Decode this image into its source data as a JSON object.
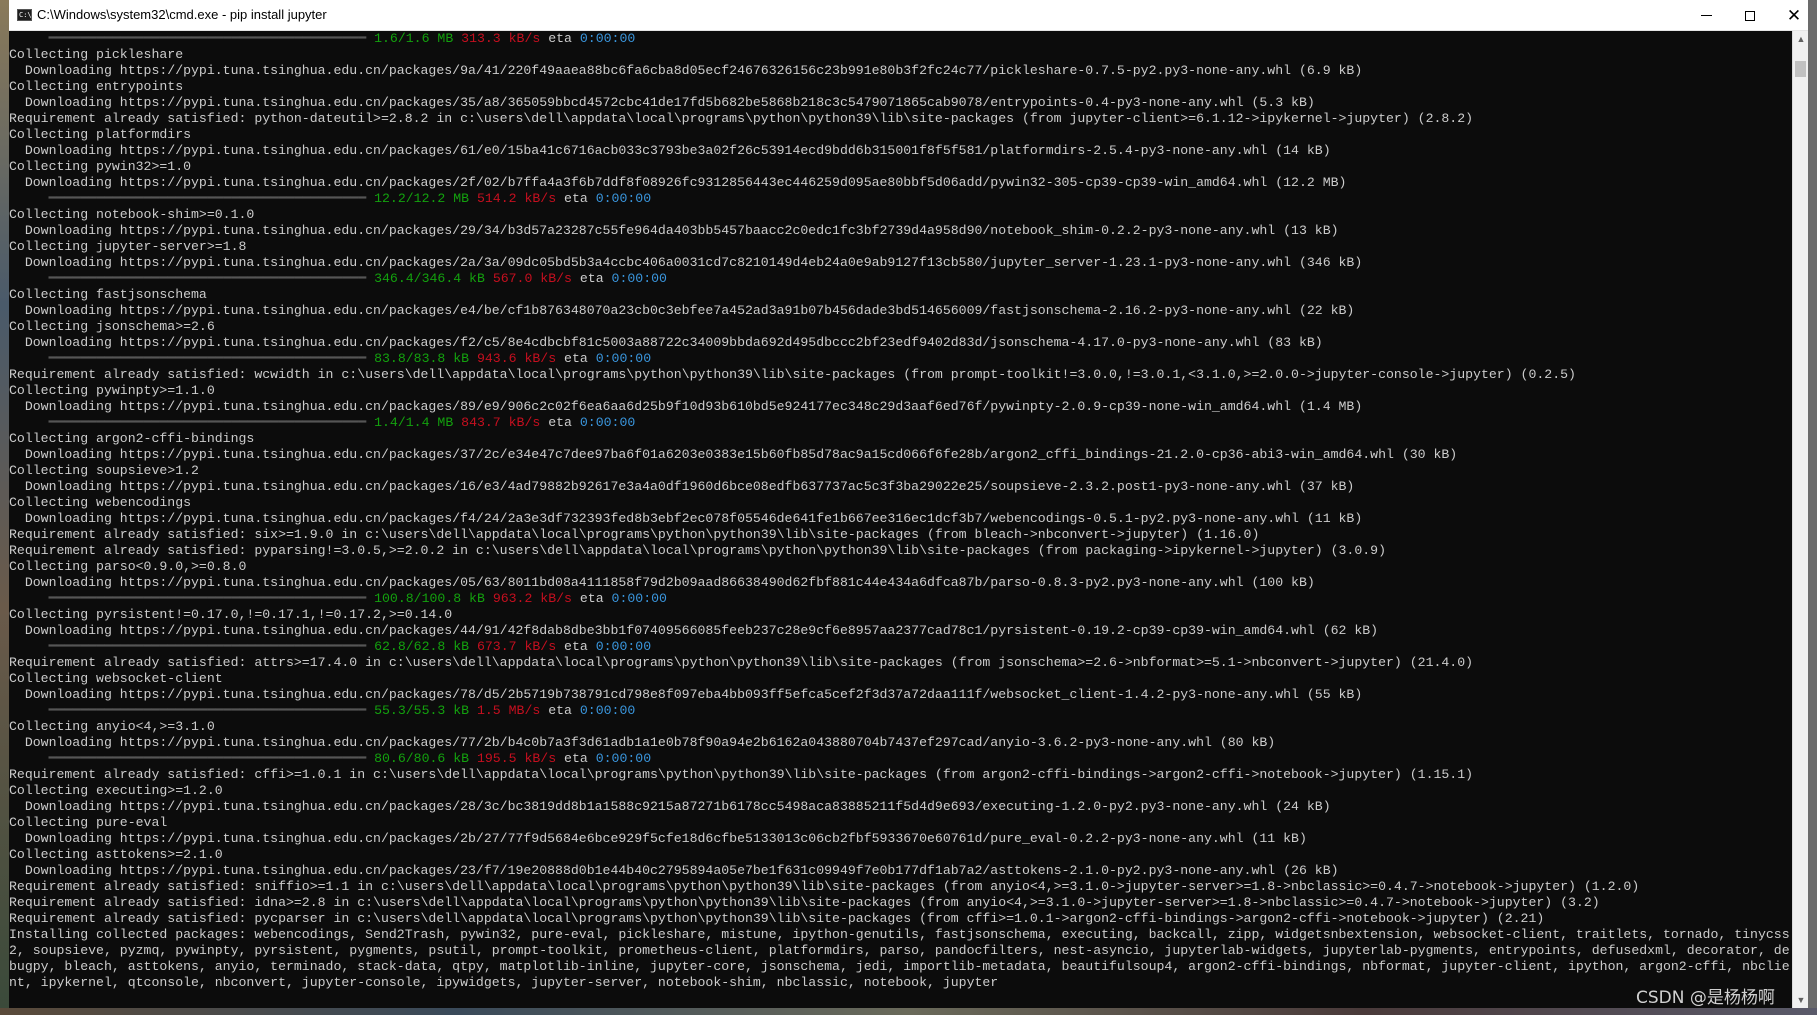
{
  "window": {
    "title": "C:\\Windows\\system32\\cmd.exe - pip  install jupyter",
    "icon": "console-icon",
    "controls": {
      "minimize": "minimize-icon",
      "maximize": "maximize-icon",
      "close": "✕"
    }
  },
  "colors": {
    "progress_size": "#13a10e",
    "progress_rate": "#c50f1f",
    "progress_eta": "#3a96dd",
    "text": "#cccccc",
    "background": "#0c0c0c"
  },
  "console": {
    "lines": [
      {
        "type": "progress",
        "indent": "     ",
        "bar": "━━━━━━━━━━━━━━━━━━━━━━━━━━━━━━━━━━━━━━━━",
        "size": "1.6/1.6 MB",
        "rate": "313.3 kB/s",
        "eta_label": "eta",
        "eta": "0:00:00"
      },
      {
        "type": "text",
        "text": "Collecting pickleshare"
      },
      {
        "type": "text",
        "text": "  Downloading https://pypi.tuna.tsinghua.edu.cn/packages/9a/41/220f49aaea88bc6fa6cba8d05ecf24676326156c23b991e80b3f2fc24c77/pickleshare-0.7.5-py2.py3-none-any.whl (6.9 kB)"
      },
      {
        "type": "text",
        "text": "Collecting entrypoints"
      },
      {
        "type": "text",
        "text": "  Downloading https://pypi.tuna.tsinghua.edu.cn/packages/35/a8/365059bbcd4572cbc41de17fd5b682be5868b218c3c5479071865cab9078/entrypoints-0.4-py3-none-any.whl (5.3 kB)"
      },
      {
        "type": "text",
        "text": "Requirement already satisfied: python-dateutil>=2.8.2 in c:\\users\\dell\\appdata\\local\\programs\\python\\python39\\lib\\site-packages (from jupyter-client>=6.1.12->ipykernel->jupyter) (2.8.2)"
      },
      {
        "type": "text",
        "text": "Collecting platformdirs"
      },
      {
        "type": "text",
        "text": "  Downloading https://pypi.tuna.tsinghua.edu.cn/packages/61/e0/15ba41c6716acb033c3793be3a02f26c53914ecd9bdd6b315001f8f5f581/platformdirs-2.5.4-py3-none-any.whl (14 kB)"
      },
      {
        "type": "text",
        "text": "Collecting pywin32>=1.0"
      },
      {
        "type": "text",
        "text": "  Downloading https://pypi.tuna.tsinghua.edu.cn/packages/2f/02/b7ffa4a3f6b7ddf8f08926fc9312856443ec446259d095ae80bbf5d06add/pywin32-305-cp39-cp39-win_amd64.whl (12.2 MB)"
      },
      {
        "type": "progress",
        "indent": "     ",
        "bar": "━━━━━━━━━━━━━━━━━━━━━━━━━━━━━━━━━━━━━━━━",
        "size": "12.2/12.2 MB",
        "rate": "514.2 kB/s",
        "eta_label": "eta",
        "eta": "0:00:00"
      },
      {
        "type": "text",
        "text": "Collecting notebook-shim>=0.1.0"
      },
      {
        "type": "text",
        "text": "  Downloading https://pypi.tuna.tsinghua.edu.cn/packages/29/34/b3d57a23287c55fe964da403bb5457baacc2c0edc1fc3bf2739d4a958d90/notebook_shim-0.2.2-py3-none-any.whl (13 kB)"
      },
      {
        "type": "text",
        "text": "Collecting jupyter-server>=1.8"
      },
      {
        "type": "text",
        "text": "  Downloading https://pypi.tuna.tsinghua.edu.cn/packages/2a/3a/09dc05bd5b3a4ccbc406a0031cd7c8210149d4eb24a0e9ab9127f13cb580/jupyter_server-1.23.1-py3-none-any.whl (346 kB)"
      },
      {
        "type": "progress",
        "indent": "     ",
        "bar": "━━━━━━━━━━━━━━━━━━━━━━━━━━━━━━━━━━━━━━━━",
        "size": "346.4/346.4 kB",
        "rate": "567.0 kB/s",
        "eta_label": "eta",
        "eta": "0:00:00"
      },
      {
        "type": "text",
        "text": "Collecting fastjsonschema"
      },
      {
        "type": "text",
        "text": "  Downloading https://pypi.tuna.tsinghua.edu.cn/packages/e4/be/cf1b876348070a23cb0c3ebfee7a452ad3a91b07b456dade3bd514656009/fastjsonschema-2.16.2-py3-none-any.whl (22 kB)"
      },
      {
        "type": "text",
        "text": "Collecting jsonschema>=2.6"
      },
      {
        "type": "text",
        "text": "  Downloading https://pypi.tuna.tsinghua.edu.cn/packages/f2/c5/8e4cdbcbf81c5003a88722c34009bbda692d495dbccc2bf23edf9402d83d/jsonschema-4.17.0-py3-none-any.whl (83 kB)"
      },
      {
        "type": "progress",
        "indent": "     ",
        "bar": "━━━━━━━━━━━━━━━━━━━━━━━━━━━━━━━━━━━━━━━━",
        "size": "83.8/83.8 kB",
        "rate": "943.6 kB/s",
        "eta_label": "eta",
        "eta": "0:00:00"
      },
      {
        "type": "text",
        "text": "Requirement already satisfied: wcwidth in c:\\users\\dell\\appdata\\local\\programs\\python\\python39\\lib\\site-packages (from prompt-toolkit!=3.0.0,!=3.0.1,<3.1.0,>=2.0.0->jupyter-console->jupyter) (0.2.5)"
      },
      {
        "type": "text",
        "text": "Collecting pywinpty>=1.1.0"
      },
      {
        "type": "text",
        "text": "  Downloading https://pypi.tuna.tsinghua.edu.cn/packages/89/e9/906c2c02f6ea6aa6d25b9f10d93b610bd5e924177ec348c29d3aaf6ed76f/pywinpty-2.0.9-cp39-none-win_amd64.whl (1.4 MB)"
      },
      {
        "type": "progress",
        "indent": "     ",
        "bar": "━━━━━━━━━━━━━━━━━━━━━━━━━━━━━━━━━━━━━━━━",
        "size": "1.4/1.4 MB",
        "rate": "843.7 kB/s",
        "eta_label": "eta",
        "eta": "0:00:00"
      },
      {
        "type": "text",
        "text": "Collecting argon2-cffi-bindings"
      },
      {
        "type": "text",
        "text": "  Downloading https://pypi.tuna.tsinghua.edu.cn/packages/37/2c/e34e47c7dee97ba6f01a6203e0383e15b60fb85d78ac9a15cd066f6fe28b/argon2_cffi_bindings-21.2.0-cp36-abi3-win_amd64.whl (30 kB)"
      },
      {
        "type": "text",
        "text": "Collecting soupsieve>1.2"
      },
      {
        "type": "text",
        "text": "  Downloading https://pypi.tuna.tsinghua.edu.cn/packages/16/e3/4ad79882b92617e3a4a0df1960d6bce08edfb637737ac5c3f3ba29022e25/soupsieve-2.3.2.post1-py3-none-any.whl (37 kB)"
      },
      {
        "type": "text",
        "text": "Collecting webencodings"
      },
      {
        "type": "text",
        "text": "  Downloading https://pypi.tuna.tsinghua.edu.cn/packages/f4/24/2a3e3df732393fed8b3ebf2ec078f05546de641fe1b667ee316ec1dcf3b7/webencodings-0.5.1-py2.py3-none-any.whl (11 kB)"
      },
      {
        "type": "text",
        "text": "Requirement already satisfied: six>=1.9.0 in c:\\users\\dell\\appdata\\local\\programs\\python\\python39\\lib\\site-packages (from bleach->nbconvert->jupyter) (1.16.0)"
      },
      {
        "type": "text",
        "text": "Requirement already satisfied: pyparsing!=3.0.5,>=2.0.2 in c:\\users\\dell\\appdata\\local\\programs\\python\\python39\\lib\\site-packages (from packaging->ipykernel->jupyter) (3.0.9)"
      },
      {
        "type": "text",
        "text": "Collecting parso<0.9.0,>=0.8.0"
      },
      {
        "type": "text",
        "text": "  Downloading https://pypi.tuna.tsinghua.edu.cn/packages/05/63/8011bd08a4111858f79d2b09aad86638490d62fbf881c44e434a6dfca87b/parso-0.8.3-py2.py3-none-any.whl (100 kB)"
      },
      {
        "type": "progress",
        "indent": "     ",
        "bar": "━━━━━━━━━━━━━━━━━━━━━━━━━━━━━━━━━━━━━━━━",
        "size": "100.8/100.8 kB",
        "rate": "963.2 kB/s",
        "eta_label": "eta",
        "eta": "0:00:00"
      },
      {
        "type": "text",
        "text": "Collecting pyrsistent!=0.17.0,!=0.17.1,!=0.17.2,>=0.14.0"
      },
      {
        "type": "text",
        "text": "  Downloading https://pypi.tuna.tsinghua.edu.cn/packages/44/91/42f8dab8dbe3bb1f07409566085feeb237c28e9cf6e8957aa2377cad78c1/pyrsistent-0.19.2-cp39-cp39-win_amd64.whl (62 kB)"
      },
      {
        "type": "progress",
        "indent": "     ",
        "bar": "━━━━━━━━━━━━━━━━━━━━━━━━━━━━━━━━━━━━━━━━",
        "size": "62.8/62.8 kB",
        "rate": "673.7 kB/s",
        "eta_label": "eta",
        "eta": "0:00:00"
      },
      {
        "type": "text",
        "text": "Requirement already satisfied: attrs>=17.4.0 in c:\\users\\dell\\appdata\\local\\programs\\python\\python39\\lib\\site-packages (from jsonschema>=2.6->nbformat>=5.1->nbconvert->jupyter) (21.4.0)"
      },
      {
        "type": "text",
        "text": "Collecting websocket-client"
      },
      {
        "type": "text",
        "text": "  Downloading https://pypi.tuna.tsinghua.edu.cn/packages/78/d5/2b5719b738791cd798e8f097eba4bb093ff5efca5cef2f3d37a72daa111f/websocket_client-1.4.2-py3-none-any.whl (55 kB)"
      },
      {
        "type": "progress",
        "indent": "     ",
        "bar": "━━━━━━━━━━━━━━━━━━━━━━━━━━━━━━━━━━━━━━━━",
        "size": "55.3/55.3 kB",
        "rate": "1.5 MB/s",
        "eta_label": "eta",
        "eta": "0:00:00"
      },
      {
        "type": "text",
        "text": "Collecting anyio<4,>=3.1.0"
      },
      {
        "type": "text",
        "text": "  Downloading https://pypi.tuna.tsinghua.edu.cn/packages/77/2b/b4c0b7a3f3d61adb1a1e0b78f90a94e2b6162a043880704b7437ef297cad/anyio-3.6.2-py3-none-any.whl (80 kB)"
      },
      {
        "type": "progress",
        "indent": "     ",
        "bar": "━━━━━━━━━━━━━━━━━━━━━━━━━━━━━━━━━━━━━━━━",
        "size": "80.6/80.6 kB",
        "rate": "195.5 kB/s",
        "eta_label": "eta",
        "eta": "0:00:00"
      },
      {
        "type": "text",
        "text": "Requirement already satisfied: cffi>=1.0.1 in c:\\users\\dell\\appdata\\local\\programs\\python\\python39\\lib\\site-packages (from argon2-cffi-bindings->argon2-cffi->notebook->jupyter) (1.15.1)"
      },
      {
        "type": "text",
        "text": "Collecting executing>=1.2.0"
      },
      {
        "type": "text",
        "text": "  Downloading https://pypi.tuna.tsinghua.edu.cn/packages/28/3c/bc3819dd8b1a1588c9215a87271b6178cc5498aca83885211f5d4d9e693/executing-1.2.0-py2.py3-none-any.whl (24 kB)"
      },
      {
        "type": "text",
        "text": "Collecting pure-eval"
      },
      {
        "type": "text",
        "text": "  Downloading https://pypi.tuna.tsinghua.edu.cn/packages/2b/27/77f9d5684e6bce929f5cfe18d6cfbe5133013c06cb2fbf5933670e60761d/pure_eval-0.2.2-py3-none-any.whl (11 kB)"
      },
      {
        "type": "text",
        "text": "Collecting asttokens>=2.1.0"
      },
      {
        "type": "text",
        "text": "  Downloading https://pypi.tuna.tsinghua.edu.cn/packages/23/f7/19e20888d0b1e44b40c2795894a05e7be1f631c09949f7e0b177df1ab7a2/asttokens-2.1.0-py2.py3-none-any.whl (26 kB)"
      },
      {
        "type": "text",
        "text": "Requirement already satisfied: sniffio>=1.1 in c:\\users\\dell\\appdata\\local\\programs\\python\\python39\\lib\\site-packages (from anyio<4,>=3.1.0->jupyter-server>=1.8->nbclassic>=0.4.7->notebook->jupyter) (1.2.0)"
      },
      {
        "type": "text",
        "text": "Requirement already satisfied: idna>=2.8 in c:\\users\\dell\\appdata\\local\\programs\\python\\python39\\lib\\site-packages (from anyio<4,>=3.1.0->jupyter-server>=1.8->nbclassic>=0.4.7->notebook->jupyter) (3.2)"
      },
      {
        "type": "text",
        "text": "Requirement already satisfied: pycparser in c:\\users\\dell\\appdata\\local\\programs\\python\\python39\\lib\\site-packages (from cffi>=1.0.1->argon2-cffi-bindings->argon2-cffi->notebook->jupyter) (2.21)"
      },
      {
        "type": "text",
        "text": "Installing collected packages: webencodings, Send2Trash, pywin32, pure-eval, pickleshare, mistune, ipython-genutils, fastjsonschema, executing, backcall, zipp, widgetsnbextension, websocket-client, traitlets, tornado, tinycss2, soupsieve, pyzmq, pywinpty, pyrsistent, pygments, psutil, prompt-toolkit, prometheus-client, platformdirs, parso, pandocfilters, nest-asyncio, jupyterlab-widgets, jupyterlab-pygments, entrypoints, defusedxml, decorator, debugpy, bleach, asttokens, anyio, terminado, stack-data, qtpy, matplotlib-inline, jupyter-core, jsonschema, jedi, importlib-metadata, beautifulsoup4, argon2-cffi-bindings, nbformat, jupyter-client, ipython, argon2-cffi, nbclient, ipykernel, qtconsole, nbconvert, jupyter-console, ipywidgets, jupyter-server, notebook-shim, nbclassic, notebook, jupyter"
      }
    ]
  },
  "watermark": "CSDN @是杨杨啊"
}
